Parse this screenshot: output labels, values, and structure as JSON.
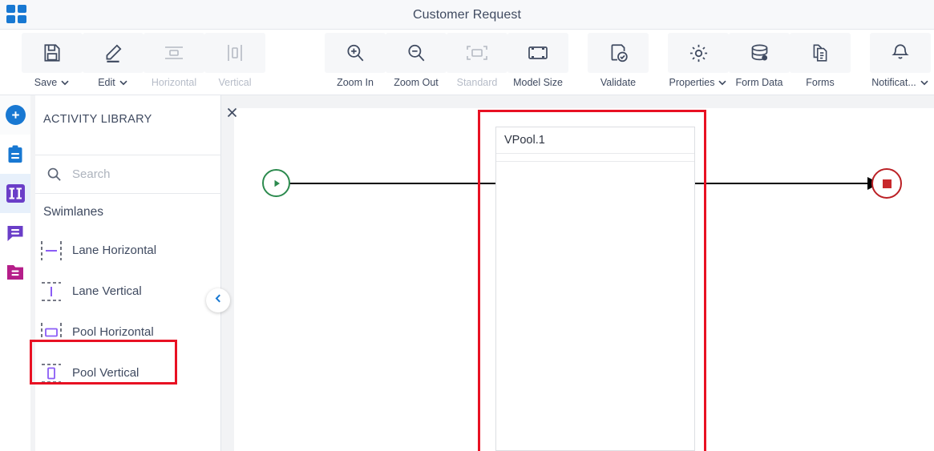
{
  "titlebar": {
    "app_icon": "grid-apps-icon",
    "title": "Customer Request"
  },
  "toolbar": {
    "items": [
      {
        "label": "Save",
        "icon": "save-disk-icon",
        "caret": true,
        "disabled": false,
        "boxed": true
      },
      {
        "label": "Edit",
        "icon": "pencil-edit-icon",
        "caret": true,
        "disabled": false,
        "boxed": true
      },
      {
        "label": "Horizontal",
        "icon": "horizontal-align-icon",
        "caret": false,
        "disabled": true,
        "boxed": true
      },
      {
        "label": "Vertical",
        "icon": "vertical-align-icon",
        "caret": false,
        "disabled": true,
        "boxed": true
      },
      {
        "label": "Zoom In",
        "icon": "zoom-in-icon",
        "caret": false,
        "disabled": false,
        "boxed": true
      },
      {
        "label": "Zoom Out",
        "icon": "zoom-out-icon",
        "caret": false,
        "disabled": false,
        "boxed": true
      },
      {
        "label": "Standard",
        "icon": "standard-size-icon",
        "caret": false,
        "disabled": true,
        "boxed": true
      },
      {
        "label": "Model Size",
        "icon": "model-size-icon",
        "caret": false,
        "disabled": false,
        "boxed": true
      },
      {
        "label": "Validate",
        "icon": "validate-check-icon",
        "caret": false,
        "disabled": false,
        "boxed": true
      },
      {
        "label": "Properties",
        "icon": "gear-icon",
        "caret": true,
        "disabled": false,
        "boxed": true
      },
      {
        "label": "Form Data",
        "icon": "database-icon",
        "caret": false,
        "disabled": false,
        "boxed": true
      },
      {
        "label": "Forms",
        "icon": "forms-copy-icon",
        "caret": false,
        "disabled": false,
        "boxed": true
      },
      {
        "label": "Notificat...",
        "icon": "bell-icon",
        "caret": true,
        "disabled": false,
        "boxed": true
      }
    ]
  },
  "rail": {
    "items": [
      {
        "name": "add-new-icon",
        "color": "#1878d2"
      },
      {
        "name": "clipboard-icon",
        "color": "#1878d2"
      },
      {
        "name": "activity-library-icon",
        "color": "#6a3ec8"
      },
      {
        "name": "comments-icon",
        "color": "#6a3ec8"
      },
      {
        "name": "documents-folder-icon",
        "color": "#b51e89"
      }
    ]
  },
  "panel": {
    "title": "ACTIVITY LIBRARY",
    "search": {
      "value": "",
      "placeholder": "Search"
    },
    "section": {
      "title": "Swimlanes",
      "close_icon": "close-icon"
    },
    "items": [
      {
        "label": "Lane Horizontal",
        "icon": "lane-horizontal-icon",
        "selected": false
      },
      {
        "label": "Lane Vertical",
        "icon": "lane-vertical-icon",
        "selected": false
      },
      {
        "label": "Pool Horizontal",
        "icon": "pool-horizontal-icon",
        "selected": false
      },
      {
        "label": "Pool Vertical",
        "icon": "pool-vertical-icon",
        "selected": true
      }
    ],
    "collapse_icon": "chevron-left-icon"
  },
  "canvas": {
    "pool": {
      "label": "VPool.1"
    },
    "start_event": {
      "icon": "start-event-play-icon",
      "color": "#2c8a4e"
    },
    "end_event": {
      "icon": "end-event-stop-icon",
      "color": "#bb2025"
    },
    "connector": {
      "icon": "sequence-flow-arrow"
    }
  },
  "annotations": {
    "highlight_color": "#e81123",
    "library_highlight_target": "Pool Vertical",
    "canvas_highlight_target": "VPool.1"
  }
}
